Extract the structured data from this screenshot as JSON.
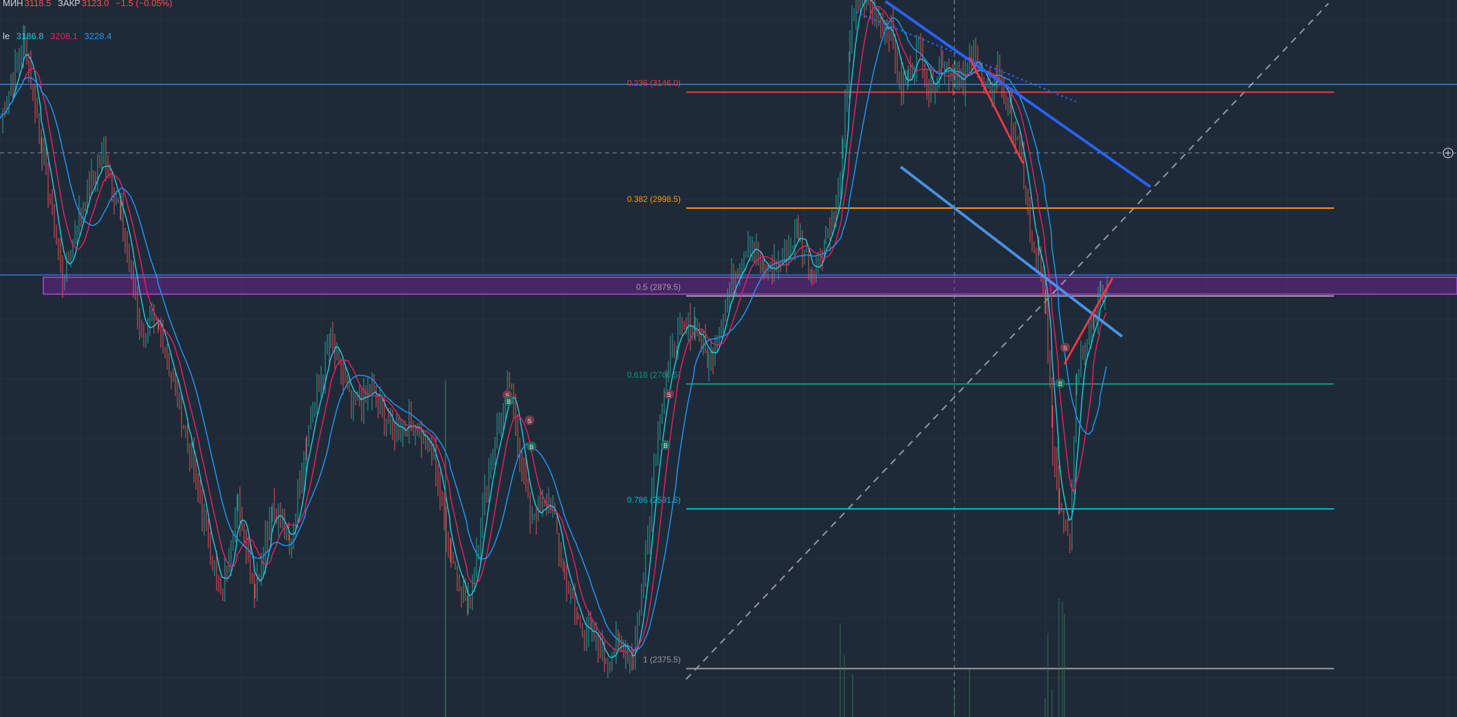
{
  "header": {
    "low_label": "МИН",
    "low_value": "3118.5",
    "close_label": "ЗАКР",
    "close_value": "3123.0",
    "change": "−1.5 (−0.05%)",
    "indicator_label": "le",
    "ma_values": [
      "3186.8",
      "3208.1",
      "3228.4"
    ]
  },
  "colors": {
    "background": "#1e2a38",
    "candle_up": "#26a69a",
    "candle_down": "#ef5350",
    "ma_fast": "#26c6da",
    "ma_mid": "#e91e63",
    "ma_slow": "#2196f3",
    "fib_0236": "#f23645",
    "fib_0382": "#ff9800",
    "fib_05": "#9e9e9e",
    "fib_0618": "#089981",
    "fib_0786": "#00bcd4",
    "fib_1": "#9e9e9e",
    "zone": "#7b1fa2",
    "trendline": "#2962ff",
    "trendline_light": "#4a90e2",
    "trendline_red": "#f23645"
  },
  "chart_data": {
    "type": "candlestick",
    "y_range": [
      2310,
      3280
    ],
    "grid": true,
    "price_path": [
      [
        0,
        3120
      ],
      [
        35,
        3225
      ],
      [
        60,
        3080
      ],
      [
        90,
        2900
      ],
      [
        120,
        3010
      ],
      [
        150,
        3070
      ],
      [
        175,
        2990
      ],
      [
        205,
        2830
      ],
      [
        230,
        2840
      ],
      [
        260,
        2730
      ],
      [
        290,
        2600
      ],
      [
        320,
        2470
      ],
      [
        345,
        2600
      ],
      [
        370,
        2480
      ],
      [
        395,
        2600
      ],
      [
        420,
        2540
      ],
      [
        445,
        2690
      ],
      [
        480,
        2820
      ],
      [
        510,
        2730
      ],
      [
        540,
        2750
      ],
      [
        570,
        2700
      ],
      [
        600,
        2710
      ],
      [
        630,
        2660
      ],
      [
        655,
        2530
      ],
      [
        680,
        2460
      ],
      [
        710,
        2650
      ],
      [
        740,
        2760
      ],
      [
        770,
        2580
      ],
      [
        800,
        2600
      ],
      [
        820,
        2500
      ],
      [
        840,
        2440
      ],
      [
        860,
        2420
      ],
      [
        880,
        2390
      ],
      [
        900,
        2410
      ],
      [
        920,
        2390
      ],
      [
        935,
        2500
      ],
      [
        950,
        2660
      ],
      [
        965,
        2760
      ],
      [
        985,
        2830
      ],
      [
        1010,
        2840
      ],
      [
        1030,
        2790
      ],
      [
        1060,
        2890
      ],
      [
        1090,
        2960
      ],
      [
        1110,
        2910
      ],
      [
        1140,
        2930
      ],
      [
        1160,
        2970
      ],
      [
        1180,
        2910
      ],
      [
        1200,
        2960
      ],
      [
        1215,
        3000
      ],
      [
        1225,
        3080
      ],
      [
        1235,
        3230
      ],
      [
        1250,
        3290
      ],
      [
        1265,
        3270
      ],
      [
        1280,
        3250
      ],
      [
        1295,
        3240
      ],
      [
        1310,
        3150
      ],
      [
        1320,
        3180
      ],
      [
        1335,
        3220
      ],
      [
        1350,
        3160
      ],
      [
        1370,
        3200
      ],
      [
        1385,
        3180
      ],
      [
        1400,
        3160
      ],
      [
        1415,
        3220
      ],
      [
        1430,
        3150
      ],
      [
        1450,
        3180
      ],
      [
        1470,
        3120
      ],
      [
        1485,
        3060
      ],
      [
        1500,
        2940
      ],
      [
        1510,
        2930
      ],
      [
        1520,
        2860
      ],
      [
        1530,
        2680
      ],
      [
        1540,
        2600
      ],
      [
        1555,
        2560
      ],
      [
        1565,
        2780
      ],
      [
        1580,
        2830
      ],
      [
        1590,
        2850
      ],
      [
        1600,
        2880
      ],
      [
        1612,
        2890
      ]
    ],
    "moving_averages": [
      "MA fast",
      "MA mid",
      "MA slow"
    ],
    "fibonacci": [
      {
        "ratio": "0.236",
        "price": "3146.0",
        "text": "0.236 (3146.0)"
      },
      {
        "ratio": "0.382",
        "price": "2998.5",
        "text": "0.382 (2998.5)"
      },
      {
        "ratio": "0.5",
        "price": "2879.5",
        "text": "0.5 (2879.5)"
      },
      {
        "ratio": "0.618",
        "price": "2760.5",
        "text": "0.618 (2760.5)"
      },
      {
        "ratio": "0.786",
        "price": "2591.5",
        "text": "0.786 (2591.5)"
      },
      {
        "ratio": "1",
        "price": "2375.5",
        "text": "1 (2375.5)"
      }
    ],
    "horizontal_levels": [
      3166,
      2908
    ],
    "dashed_level": 3073,
    "zone": [
      2882,
      2905
    ],
    "crosshair_date_x": 1388,
    "markers": [
      "S",
      "B",
      "S",
      "B",
      "S",
      "B",
      "S",
      "B"
    ]
  }
}
